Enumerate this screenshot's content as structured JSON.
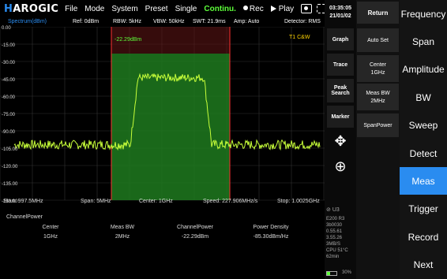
{
  "topbar": {
    "logo": "HAROGIC",
    "menu": [
      "File",
      "Mode",
      "System",
      "Preset",
      "Single",
      "Continu.",
      "Rec",
      "Play"
    ]
  },
  "spectrum": {
    "title": "Spectrum(dBm)",
    "ref": "Ref: 0dBm",
    "rbw": "RBW: 5kHz",
    "vbw": "VBW: 50kHz",
    "swt": "SWT: 21.9ms",
    "amp": "Amp: Auto",
    "detector": "Detector: RMS",
    "marker_label": "-22.29dBm",
    "trace_label": "T1 C&W",
    "y_ticks": [
      "0.00",
      "-15.00",
      "-30.00",
      "-45.00",
      "-60.00",
      "-75.00",
      "-90.00",
      "-105.00",
      "-120.00",
      "-135.00",
      "-150.00"
    ],
    "start": "Start: 997.5MHz",
    "span": "Span: 5MHz",
    "center": "Center: 1GHz",
    "speed": "Speed: 227.906MHz/s",
    "stop": "Stop: 1.0025GHz"
  },
  "results": {
    "title": "ChannelPower",
    "headers": [
      "Center",
      "Meas BW",
      "ChannelPower",
      "Power Density"
    ],
    "values": [
      "1GHz",
      "2MHz",
      "-22.29dBm",
      "-85.30dBm/Hz"
    ]
  },
  "mid": {
    "time": "03:35:05",
    "date": "21/01/02",
    "buttons": [
      "Graph",
      "Trace",
      "Peak Search",
      "Marker"
    ],
    "sys_info": [
      "U3",
      "E200 R3",
      "3b0030",
      "0.55.61",
      "3.55.26",
      "3MB/S",
      "CPU 51°C",
      "62min"
    ],
    "battery_text": "30%",
    "battery_fill": 0.3
  },
  "softkeys": {
    "return": "Return",
    "auto_set": "Auto Set",
    "center_label": "Center",
    "center_value": "1GHz",
    "meas_bw_label": "Meas BW",
    "meas_bw_value": "2MHz",
    "span_power": "SpanPower"
  },
  "right_menu": [
    "Frequency",
    "Span",
    "Amplitude",
    "BW",
    "Sweep",
    "Detect",
    "Meas",
    "Trigger",
    "Record",
    "Next"
  ],
  "active_menu": "Meas",
  "colors": {
    "trace": "#c8ff3a",
    "accent": "#2a8cf0",
    "channel_fill": "#1f7a1f",
    "channel_border": "#ff3030"
  }
}
